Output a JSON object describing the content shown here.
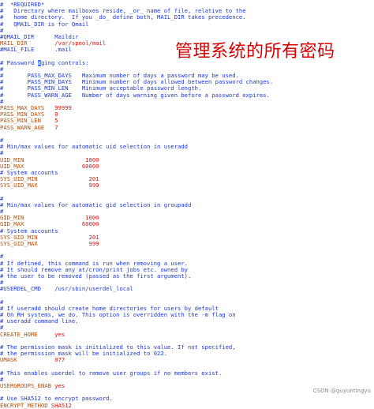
{
  "overlay_text": "管理系统的所有密码",
  "watermark": "CSDN @guyuntingyu",
  "lines": [
    {
      "t": "c",
      "s": "#  *REQUIRED*"
    },
    {
      "t": "c",
      "s": "#   Directory where mailboxes reside, _or_ name of file, relative to the"
    },
    {
      "t": "c",
      "s": "#   home directory.  If you _do_ define both, MAIL_DIR takes precedence."
    },
    {
      "t": "c",
      "s": "#   QMAIL_DIR is for Qmail"
    },
    {
      "t": "c",
      "s": "#"
    },
    {
      "t": "c",
      "s": "#QMAIL_DIR      Maildir"
    },
    {
      "t": "kv",
      "k": "MAIL_DIR",
      "v": "        /var/spool/mail"
    },
    {
      "t": "c",
      "s": "#MAIL_FILE      .mail"
    },
    {
      "t": "c",
      "s": ""
    },
    {
      "t": "cur",
      "a": "# Password ",
      "b": "a",
      "c": "ging controls:"
    },
    {
      "t": "c",
      "s": "#"
    },
    {
      "t": "c",
      "s": "#       PASS_MAX_DAYS   Maximum number of days a password may be used."
    },
    {
      "t": "c",
      "s": "#       PASS_MIN_DAYS   Minimum number of days allowed between password changes."
    },
    {
      "t": "c",
      "s": "#       PASS_MIN_LEN    Minimum acceptable password length."
    },
    {
      "t": "c",
      "s": "#       PASS_WARN_AGE   Number of days warning given before a password expires."
    },
    {
      "t": "c",
      "s": "#"
    },
    {
      "t": "kv",
      "k": "PASS_MAX_DAYS",
      "v": "   99999"
    },
    {
      "t": "kv",
      "k": "PASS_MIN_DAYS",
      "v": "   0"
    },
    {
      "t": "kv",
      "k": "PASS_MIN_LEN",
      "v": "    5"
    },
    {
      "t": "kv",
      "k": "PASS_WARN_AGE",
      "v": "   7"
    },
    {
      "t": "c",
      "s": ""
    },
    {
      "t": "c",
      "s": "#"
    },
    {
      "t": "c",
      "s": "# Min/max values for automatic uid selection in useradd"
    },
    {
      "t": "c",
      "s": "#"
    },
    {
      "t": "kv",
      "k": "UID_MIN",
      "v": "                  1000"
    },
    {
      "t": "kv",
      "k": "UID_MAX",
      "v": "                 60000"
    },
    {
      "t": "c",
      "s": "# System accounts"
    },
    {
      "t": "kv",
      "k": "SYS_UID_MIN",
      "v": "               201"
    },
    {
      "t": "kv",
      "k": "SYS_UID_MAX",
      "v": "               999"
    },
    {
      "t": "c",
      "s": ""
    },
    {
      "t": "c",
      "s": "#"
    },
    {
      "t": "c",
      "s": "# Min/max values for automatic gid selection in groupadd"
    },
    {
      "t": "c",
      "s": "#"
    },
    {
      "t": "kv",
      "k": "GID_MIN",
      "v": "                  1000"
    },
    {
      "t": "kv",
      "k": "GID_MAX",
      "v": "                 60000"
    },
    {
      "t": "c",
      "s": "# System accounts"
    },
    {
      "t": "kv",
      "k": "SYS_GID_MIN",
      "v": "               201"
    },
    {
      "t": "kv",
      "k": "SYS_GID_MAX",
      "v": "               999"
    },
    {
      "t": "c",
      "s": ""
    },
    {
      "t": "c",
      "s": "#"
    },
    {
      "t": "c",
      "s": "# If defined, this command is run when removing a user."
    },
    {
      "t": "c",
      "s": "# It should remove any at/cron/print jobs etc. owned by"
    },
    {
      "t": "c",
      "s": "# the user to be removed (passed as the first argument)."
    },
    {
      "t": "c",
      "s": "#"
    },
    {
      "t": "c",
      "s": "#USERDEL_CMD    /usr/sbin/userdel_local"
    },
    {
      "t": "c",
      "s": ""
    },
    {
      "t": "c",
      "s": "#"
    },
    {
      "t": "c",
      "s": "# If useradd should create home directories for users by default"
    },
    {
      "t": "c",
      "s": "# On RH systems, we do. This option is overridden with the -m flag on"
    },
    {
      "t": "c",
      "s": "# useradd command line."
    },
    {
      "t": "c",
      "s": "#"
    },
    {
      "t": "kv",
      "k": "CREATE_HOME",
      "v": "     yes"
    },
    {
      "t": "c",
      "s": ""
    },
    {
      "t": "c",
      "s": "# The permission mask is initialized to this value. If not specified,"
    },
    {
      "t": "c",
      "s": "# the permission mask will be initialized to 022."
    },
    {
      "t": "kv",
      "k": "UMASK",
      "v": "           077"
    },
    {
      "t": "c",
      "s": ""
    },
    {
      "t": "c",
      "s": "# This enables userdel to remove user groups if no members exist."
    },
    {
      "t": "c",
      "s": "#"
    },
    {
      "t": "kv",
      "k": "USERGROUPS_ENAB",
      "v": " yes"
    },
    {
      "t": "c",
      "s": ""
    },
    {
      "t": "c",
      "s": "# Use SHA512 to encrypt password."
    },
    {
      "t": "kv",
      "k": "ENCRYPT_METHOD",
      "v": " SHA512"
    }
  ]
}
